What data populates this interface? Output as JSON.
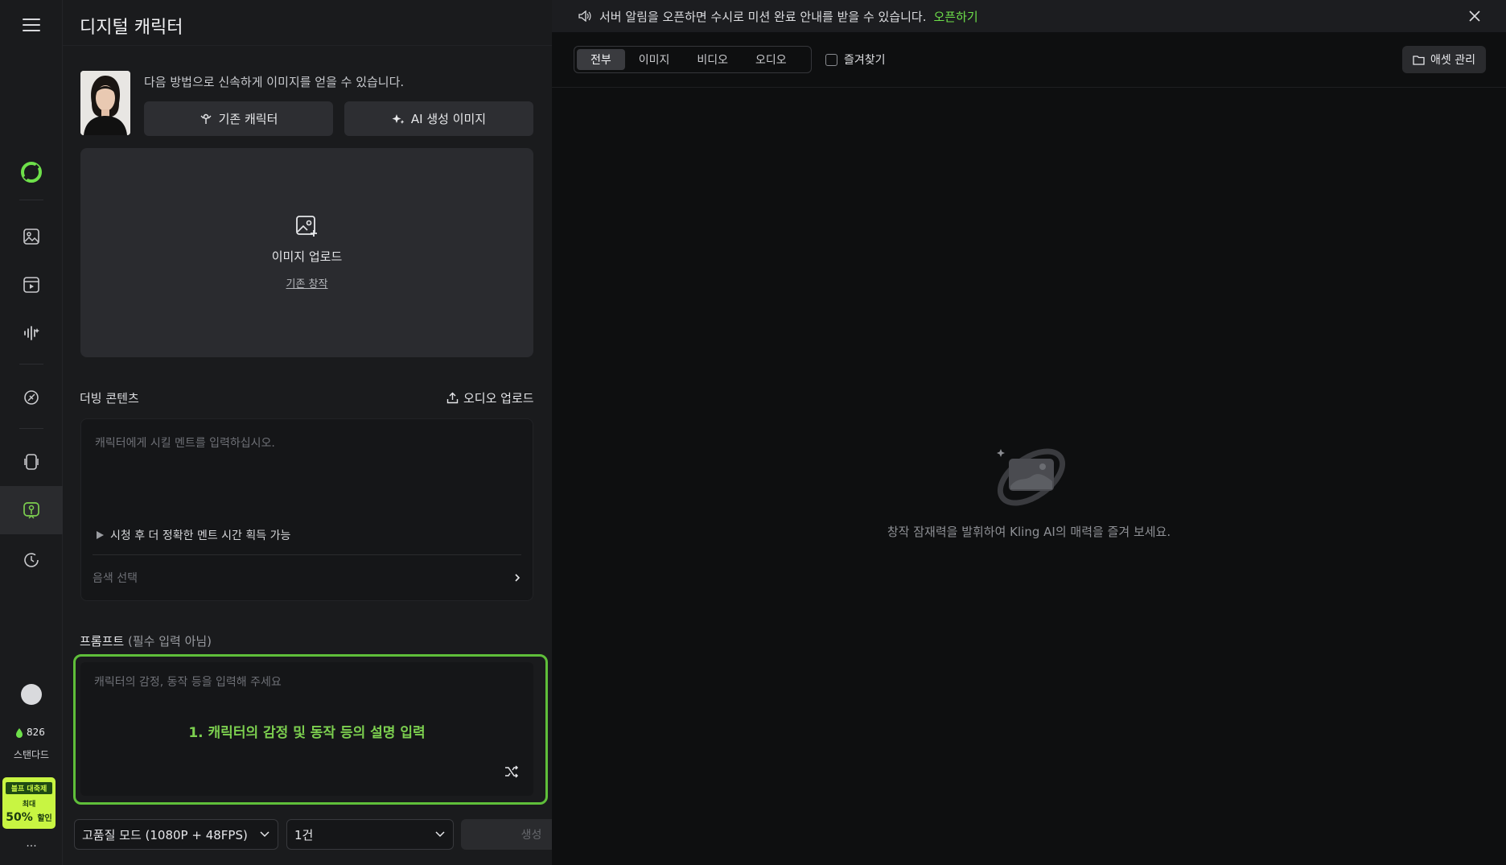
{
  "panel": {
    "title": "디지털 캐릭터",
    "hint": "다음 방법으로 신속하게 이미지를 얻을 수 있습니다.",
    "existing_character_label": "기존 캐릭터",
    "ai_image_label": "AI 생성 이미지",
    "upload_label": "이미지 업로드",
    "existing_creation_link": "기존 창작",
    "dubbing_label": "더빙 콘텐츠",
    "audio_upload_label": "오디오 업로드",
    "dubbing_placeholder": "캐릭터에게 시킬 멘트를 입력하십시오.",
    "preview_hint": "시청 후 더 정확한 멘트 시간 획득 가능",
    "voice_select_label": "음색 선택",
    "prompt_label": "프롬프트",
    "prompt_optional": "(필수 입력 아님)",
    "prompt_placeholder": "캐릭터의 감정, 동작 등을 입력해 주세요",
    "annotation": "1. 캐릭터의 감정 및 동작 등의 설명 입력",
    "quality_mode": "고품질 모드 (1080P + 48FPS)",
    "count": "1건",
    "generate_label": "생성"
  },
  "rail": {
    "credits": "826",
    "plan": "스탠다드",
    "promo_title": "블프 대축제",
    "promo_line2": "최대",
    "promo_discount": "50%",
    "promo_suffix": "할인",
    "more": "..."
  },
  "main": {
    "notice_text": "서버 알림을 오픈하면 수시로 미션 완료 안내를 받을 수 있습니다.",
    "notice_action": "오픈하기",
    "tabs": [
      "전부",
      "이미지",
      "비디오",
      "오디오"
    ],
    "favorites_label": "즐겨찾기",
    "asset_manage_label": "애셋 관리",
    "empty_text": "창작 잠재력을 발휘하여 Kling AI의 매력을 즐겨 보세요."
  },
  "colors": {
    "accent": "#5fbf3a",
    "annotation": "#7ccf4f",
    "promo_bg": "#c8f542"
  }
}
